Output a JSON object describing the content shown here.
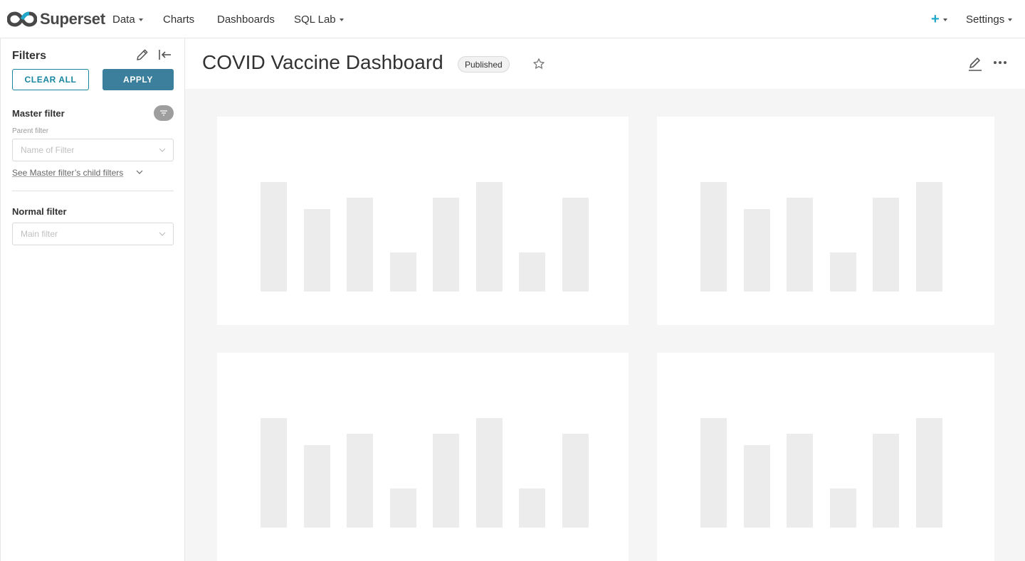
{
  "navbar": {
    "brand": "Superset",
    "items": [
      {
        "label": "Data",
        "has_caret": true
      },
      {
        "label": "Charts",
        "has_caret": false
      },
      {
        "label": "Dashboards",
        "has_caret": false
      },
      {
        "label": "SQL Lab",
        "has_caret": true
      }
    ],
    "new_icon": "plus-icon",
    "settings_label": "Settings"
  },
  "sidebar": {
    "title": "Filters",
    "edit_icon": "pencil-icon",
    "collapse_icon": "collapse-left-icon",
    "clear_all_label": "CLEAR ALL",
    "apply_label": "APPLY",
    "master_filter": {
      "name": "Master filter",
      "parent_label": "Parent filter",
      "placeholder": "Name of Filter",
      "child_link": "See Master filter’s child filters"
    },
    "normal_filter": {
      "name": "Normal filter",
      "placeholder": "Main filter"
    }
  },
  "dashboard": {
    "title": "COVID Vaccine Dashboard",
    "status": "Published",
    "star_icon": "star-icon",
    "edit_icon": "edit-icon",
    "more_icon": "more-horizontal-icon"
  },
  "colors": {
    "primary": "#1985a0",
    "apply_bg": "#3b7f9c",
    "placeholder_bar": "#ececec",
    "page_bg": "#f5f5f5"
  },
  "chart_placeholders": {
    "bar_levels_wide": [
      1.0,
      0.75,
      0.86,
      0.36,
      0.86,
      1.0,
      0.36,
      0.86
    ],
    "bar_levels_narrow": [
      1.0,
      0.75,
      0.86,
      0.36,
      0.86,
      1.0
    ]
  }
}
